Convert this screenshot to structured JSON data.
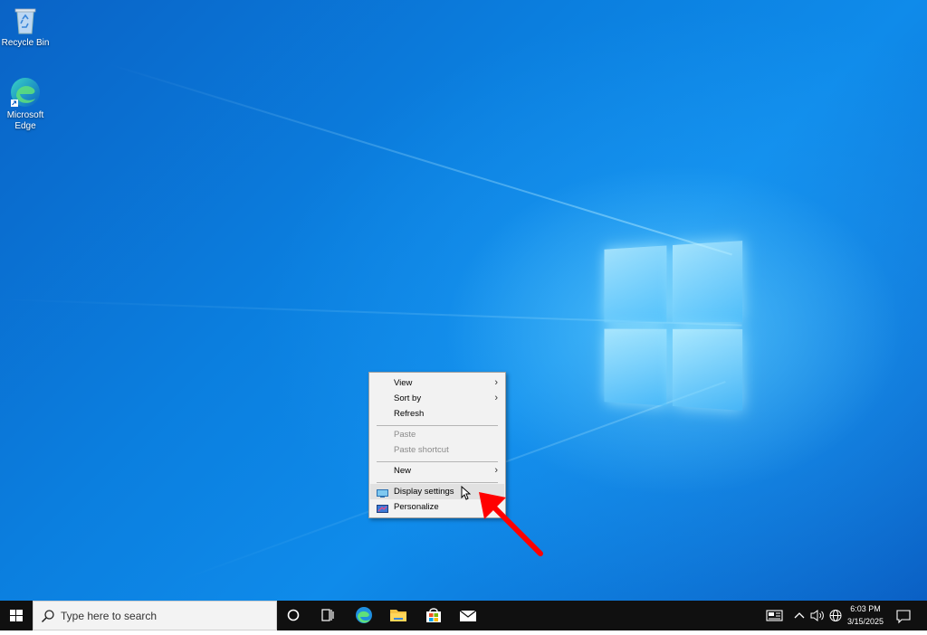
{
  "desktop": {
    "icons": [
      {
        "label": "Recycle Bin",
        "icon": "recycle-bin-icon"
      },
      {
        "label": "Microsoft Edge",
        "icon": "edge-icon"
      }
    ]
  },
  "context_menu": {
    "items": [
      {
        "label": "View",
        "submenu": true,
        "enabled": true
      },
      {
        "label": "Sort by",
        "submenu": true,
        "enabled": true
      },
      {
        "label": "Refresh",
        "submenu": false,
        "enabled": true
      },
      {
        "label": "Paste",
        "submenu": false,
        "enabled": false
      },
      {
        "label": "Paste shortcut",
        "submenu": false,
        "enabled": false
      },
      {
        "label": "New",
        "submenu": true,
        "enabled": true
      },
      {
        "label": "Display settings",
        "submenu": false,
        "enabled": true,
        "icon": "display-icon",
        "hovered": true
      },
      {
        "label": "Personalize",
        "submenu": false,
        "enabled": true,
        "icon": "personalize-icon"
      }
    ]
  },
  "taskbar": {
    "search_placeholder": "Type here to search",
    "pinned": [
      "cortana-icon",
      "task-view-icon",
      "edge-icon",
      "file-explorer-icon",
      "store-icon",
      "mail-icon"
    ],
    "tray": {
      "time": "6:03 PM",
      "date": "3/15/2025"
    }
  },
  "annotation": {
    "color": "#ff0000"
  }
}
